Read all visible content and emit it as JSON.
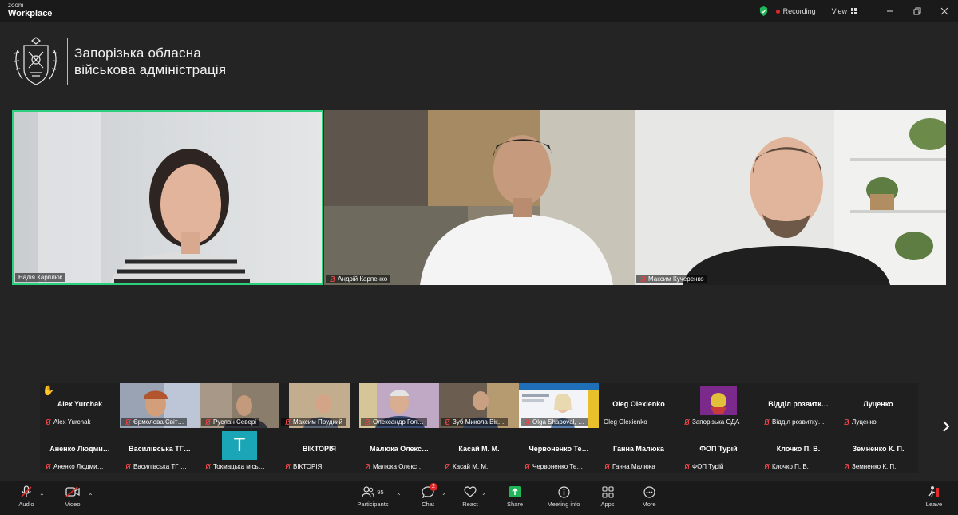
{
  "app": {
    "brand_small": "zoom",
    "brand_name": "Workplace"
  },
  "titlebar": {
    "recording_label": "Recording",
    "view_label": "View"
  },
  "org": {
    "line1": "Запорізька обласна",
    "line2": "військова адміністрація"
  },
  "colors": {
    "active_speaker": "#2cd07e",
    "recording": "#e02828",
    "share": "#1fb65a"
  },
  "main_tiles": [
    {
      "name": "Надія Карплюк",
      "muted": false,
      "active": true
    },
    {
      "name": "Андрій Карпенко",
      "muted": true,
      "active": false
    },
    {
      "name": "Максим Кучеренко",
      "muted": true,
      "active": false
    }
  ],
  "strip_row1": [
    {
      "display": "Alex Yurchak",
      "name": "Alex Yurchak",
      "hand": true,
      "photo": false
    },
    {
      "display": "",
      "name": "Єрмолова Світ…",
      "photo": true
    },
    {
      "display": "",
      "name": "Руслан Северi",
      "photo": true
    },
    {
      "display": "",
      "name": "Максим Прудкий",
      "photo": true
    },
    {
      "display": "",
      "name": "Олександр Гол…",
      "photo": true
    },
    {
      "display": "",
      "name": "Зуб Микола Вік…",
      "photo": true
    },
    {
      "display": "",
      "name": "Olga Shapoval, …",
      "photo": true,
      "muted": false
    },
    {
      "display": "Oleg Olexienko",
      "name": "Oleg Olexienko",
      "photo": false
    },
    {
      "display": "",
      "name": "Запорізька ОДА",
      "photo": true
    },
    {
      "display": "Відділ розвитк…",
      "name": "Відділ розвитку…",
      "photo": false
    },
    {
      "display": "Луценко",
      "name": "Луценко",
      "photo": false
    }
  ],
  "strip_row2": [
    {
      "display": "Аненко Людми…",
      "name": "Аненко Людми…"
    },
    {
      "display": "Василівська ТГ…",
      "name": "Василівська ТГ …"
    },
    {
      "display": "T",
      "name": "Токмацька місь…",
      "avatar": true
    },
    {
      "display": "ВІКТОРІЯ",
      "name": "ВІКТОРІЯ"
    },
    {
      "display": "Малюка Олекс…",
      "name": "Малюка Олекс…"
    },
    {
      "display": "Касай М. М.",
      "name": "Касай М. М."
    },
    {
      "display": "Червоненко Те…",
      "name": "Червоненко Те…"
    },
    {
      "display": "Ганна Малюка",
      "name": "Ганна Малюка"
    },
    {
      "display": "ФОП Турій",
      "name": "ФОП Турій"
    },
    {
      "display": "Клочко П. В.",
      "name": "Клочко П. В."
    },
    {
      "display": "Земненко К. П.",
      "name": "Земненко К. П."
    }
  ],
  "toolbar": {
    "audio": "Audio",
    "video": "Video",
    "participants": "Participants",
    "participants_count": "95",
    "chat": "Chat",
    "chat_badge": "2",
    "react": "React",
    "share": "Share",
    "meeting_info": "Meeting info",
    "apps": "Apps",
    "more": "More",
    "leave": "Leave"
  }
}
